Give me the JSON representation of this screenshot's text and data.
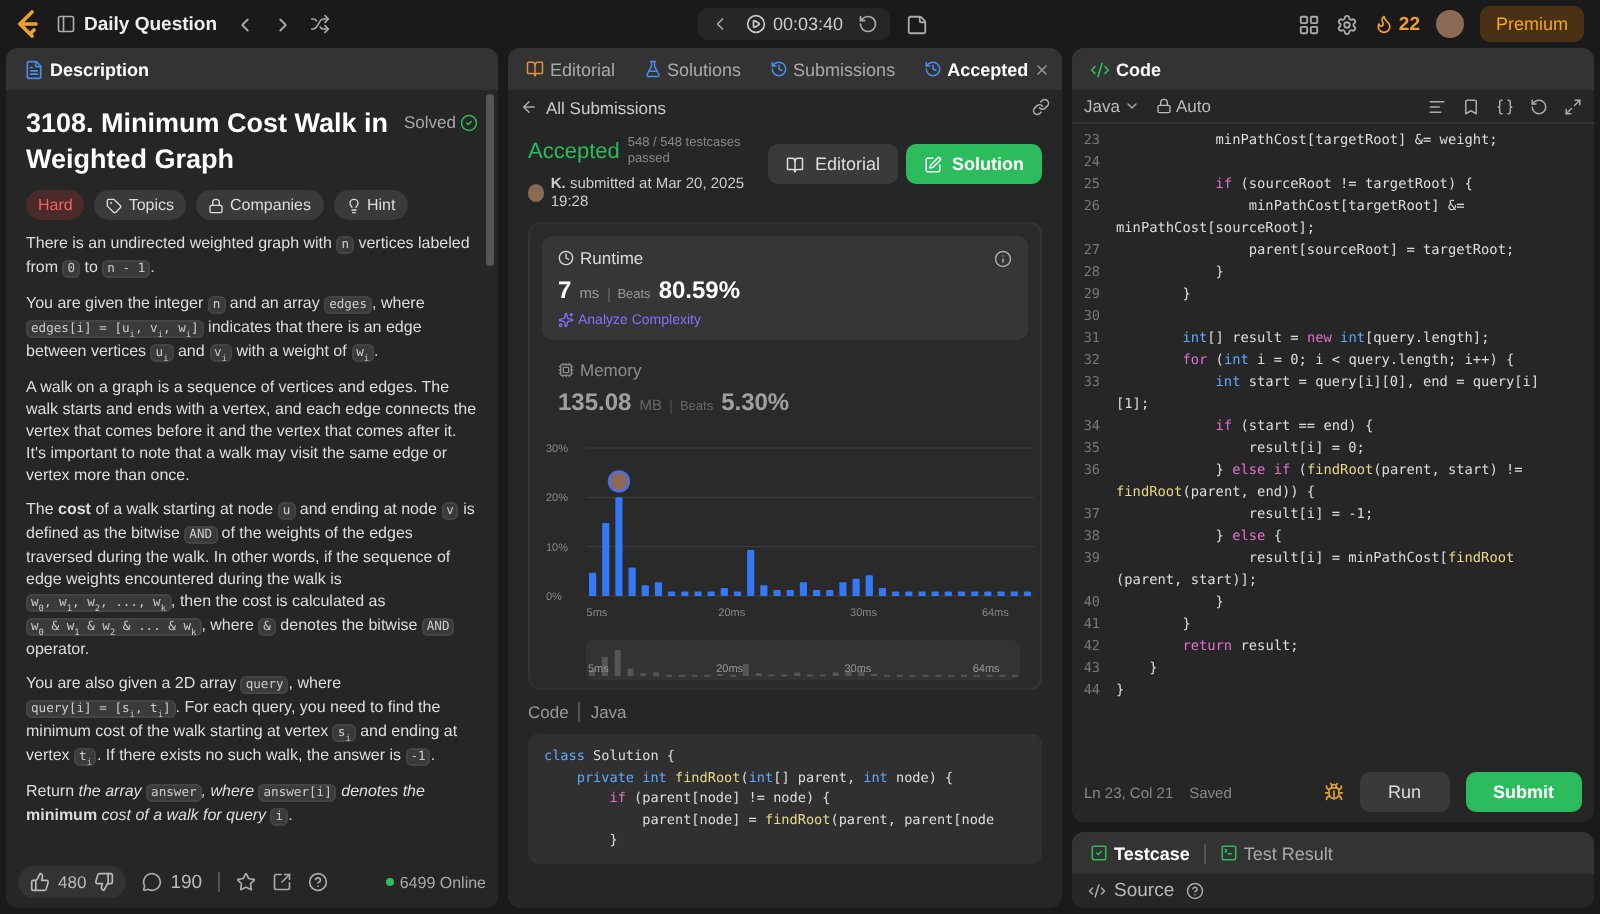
{
  "top_bar": {
    "title": "Daily Question",
    "timer": "00:03:40",
    "streak": "22",
    "premium": "Premium"
  },
  "description_panel": {
    "tab": {
      "label": "Description",
      "selected": true
    },
    "title": "3108. Minimum Cost Walk in Weighted Graph",
    "status": "Solved",
    "difficulty": "Hard",
    "tags": [
      "Topics",
      "Companies",
      "Hint"
    ],
    "paragraphs": [
      [
        {
          "kind": "text",
          "text": "There is an undirected weighted graph with "
        },
        {
          "kind": "code",
          "text": "n"
        },
        {
          "kind": "text",
          "text": " vertices labeled from "
        },
        {
          "kind": "code",
          "text": "0"
        },
        {
          "kind": "text",
          "text": " to "
        },
        {
          "kind": "code",
          "text": "n - 1"
        },
        {
          "kind": "text",
          "text": "."
        }
      ],
      [
        {
          "kind": "text",
          "text": "You are given the integer "
        },
        {
          "kind": "code",
          "text": "n"
        },
        {
          "kind": "text",
          "text": " and an array "
        },
        {
          "kind": "code",
          "text": "edges"
        },
        {
          "kind": "text",
          "text": ", where "
        },
        {
          "kind": "code",
          "text": "edges[i] = [u$_{i}$, v$_{i}$, w$_{i}$]"
        },
        {
          "kind": "text",
          "text": " indicates that there is an edge between vertices "
        },
        {
          "kind": "code",
          "text": "u$_{i}$"
        },
        {
          "kind": "text",
          "text": " and "
        },
        {
          "kind": "code",
          "text": "v$_{i}$"
        },
        {
          "kind": "text",
          "text": " with a weight of "
        },
        {
          "kind": "code",
          "text": "w$_{i}$"
        },
        {
          "kind": "text",
          "text": "."
        }
      ],
      [
        {
          "kind": "text",
          "text": "A walk on a graph is a sequence of vertices and edges. The walk starts and ends with a vertex, and each edge connects the vertex that comes before it and the vertex that comes after it. It's important to note that a walk may visit the same edge or vertex more than once."
        }
      ],
      [
        {
          "kind": "text",
          "text": "The **cost** of a walk starting at node "
        },
        {
          "kind": "code",
          "text": "u"
        },
        {
          "kind": "text",
          "text": " and ending at node "
        },
        {
          "kind": "code",
          "text": "v"
        },
        {
          "kind": "text",
          "text": " is defined as the bitwise "
        },
        {
          "kind": "code",
          "text": "AND"
        },
        {
          "kind": "text",
          "text": " of the weights of the edges traversed during the walk. In other words, if the sequence of edge weights encountered during the walk is "
        },
        {
          "kind": "code",
          "text": "w$_{0}$, w$_{1}$, w$_{2}$, ..., w$_{k}$"
        },
        {
          "kind": "text",
          "text": ", then the cost is calculated as "
        },
        {
          "kind": "code",
          "text": "w$_{0}$ & w$_{1}$ & w$_{2}$ & ... & w$_{k}$"
        },
        {
          "kind": "text",
          "text": ", where "
        },
        {
          "kind": "code",
          "text": "&"
        },
        {
          "kind": "text",
          "text": " denotes the bitwise "
        },
        {
          "kind": "code",
          "text": "AND"
        },
        {
          "kind": "text",
          "text": " operator."
        }
      ],
      [
        {
          "kind": "text",
          "text": "You are also given a 2D array "
        },
        {
          "kind": "code",
          "text": "query"
        },
        {
          "kind": "text",
          "text": ", where "
        },
        {
          "kind": "code",
          "text": "query[i] = [s$_{i}$, t$_{i}$]"
        },
        {
          "kind": "text",
          "text": ". For each query, you need to find the minimum cost of the walk starting at vertex "
        },
        {
          "kind": "code",
          "text": "s$_{i}$"
        },
        {
          "kind": "text",
          "text": " and ending at vertex "
        },
        {
          "kind": "code",
          "text": "t$_{i}$"
        },
        {
          "kind": "text",
          "text": ". If there exists no such walk, the answer is "
        },
        {
          "kind": "code",
          "text": "-1"
        },
        {
          "kind": "text",
          "text": "."
        }
      ],
      [
        {
          "kind": "text",
          "text": "Return *the array* "
        },
        {
          "kind": "code",
          "text": "answer"
        },
        {
          "kind": "text",
          "text": "*, where* "
        },
        {
          "kind": "code",
          "text": "answer[i]"
        },
        {
          "kind": "text",
          "text": " *denotes the* **minimum** *cost of a walk for query* "
        },
        {
          "kind": "code",
          "text": "i"
        },
        {
          "kind": "text",
          "text": "."
        }
      ]
    ],
    "footer": {
      "likes": "480",
      "comments": "190",
      "online": "6499 Online"
    }
  },
  "submission_panel": {
    "tabs": [
      {
        "label": "Editorial",
        "selected": false,
        "closable": false
      },
      {
        "label": "Solutions",
        "selected": false,
        "closable": false
      },
      {
        "label": "Submissions",
        "selected": false,
        "closable": false
      },
      {
        "label": "Accepted",
        "selected": true,
        "closable": true
      }
    ],
    "back_link": "All Submissions",
    "verdict": "Accepted",
    "testcases": "548 / 548 testcases passed",
    "submitted": "**K.** submitted at Mar 20, 2025 19:28",
    "buttons": [
      {
        "label": "Editorial",
        "kind": "secondary"
      },
      {
        "label": "Solution",
        "kind": "primary"
      }
    ],
    "metrics": [
      {
        "label": "Runtime",
        "value": "7",
        "unit": "ms",
        "beats_label": "Beats",
        "beats": "80.59%",
        "link": "Analyze Complexity",
        "selected": true
      },
      {
        "label": "Memory",
        "value": "135.08",
        "unit": "MB",
        "beats_label": "Beats",
        "beats": "5.30%",
        "selected": false
      }
    ],
    "chart_data": {
      "type": "bar",
      "categories": [
        "5ms",
        null,
        null,
        null,
        null,
        null,
        null,
        null,
        null,
        null,
        "20ms",
        null,
        null,
        null,
        null,
        null,
        null,
        null,
        null,
        null,
        "30ms",
        null,
        null,
        null,
        null,
        null,
        null,
        null,
        null,
        null,
        "64ms",
        null,
        null,
        null
      ],
      "values": [
        4.7,
        14.8,
        20,
        5.8,
        2.2,
        2.8,
        0.9,
        0.9,
        0.9,
        0.9,
        1.6,
        0.9,
        9.3,
        2.2,
        1.2,
        1.2,
        2.8,
        1.2,
        1.2,
        2.8,
        3.5,
        4.2,
        1.6,
        0.9,
        0.9,
        0.9,
        0.9,
        0.9,
        0.9,
        0.9,
        0.9,
        0.9,
        0.9,
        0.9
      ],
      "ylim": [
        0,
        30
      ],
      "yticks": [
        {
          "value": 0,
          "label": "0%"
        },
        {
          "value": 10,
          "label": "10%"
        },
        {
          "value": 20,
          "label": "20%"
        },
        {
          "value": 30,
          "label": "30%"
        }
      ]
    },
    "overview_labels": [
      "5ms",
      "20ms",
      "30ms",
      "64ms"
    ],
    "code_label": "Code",
    "code_language": "Java",
    "code": [
      [
        {
          "kind": "type",
          "text": "class"
        },
        {
          "kind": "p",
          "text": " Solution {"
        }
      ],
      [
        {
          "kind": "type",
          "text": "    private int"
        },
        {
          "kind": "fn",
          "text": " findRoot"
        },
        {
          "kind": "p",
          "text": "("
        },
        {
          "kind": "type",
          "text": "int"
        },
        {
          "kind": "p",
          "text": "[] parent, "
        },
        {
          "kind": "type",
          "text": "int"
        },
        {
          "kind": "p",
          "text": " node) {"
        }
      ],
      [
        {
          "kind": "kw",
          "text": "        if"
        },
        {
          "kind": "p",
          "text": " (parent[node] != node) {"
        }
      ],
      [
        {
          "kind": "p",
          "text": "            parent[node] = "
        },
        {
          "kind": "fn",
          "text": "findRoot"
        },
        {
          "kind": "p",
          "text": "(parent, parent[node"
        }
      ],
      [
        {
          "kind": "p",
          "text": "        }"
        }
      ]
    ]
  },
  "code_panel": {
    "title": "Code",
    "language": "Java",
    "mode": "Auto",
    "rows": [
      {
        "num": "23",
        "code": [
          {
            "kind": "p",
            "text": "            minPathCost[targetRoot] &= weight;"
          }
        ]
      },
      {
        "num": "24"
      },
      {
        "num": "25",
        "code": [
          {
            "kind": "kw",
            "text": "            if"
          },
          {
            "kind": "p",
            "text": " (sourceRoot != targetRoot) {"
          }
        ]
      },
      {
        "num": "26",
        "code": [
          {
            "kind": "p",
            "text": "                minPathCost[targetRoot] &="
          }
        ]
      },
      {
        "code": [
          {
            "kind": "p",
            "text": "minPathCost[sourceRoot];"
          }
        ]
      },
      {
        "num": "27",
        "code": [
          {
            "kind": "p",
            "text": "                parent[sourceRoot] = targetRoot;"
          }
        ]
      },
      {
        "num": "28",
        "code": [
          {
            "kind": "p",
            "text": "            }"
          }
        ]
      },
      {
        "num": "29",
        "code": [
          {
            "kind": "p",
            "text": "        }"
          }
        ]
      },
      {
        "num": "30"
      },
      {
        "num": "31",
        "code": [
          {
            "kind": "type",
            "text": "        int"
          },
          {
            "kind": "p",
            "text": "[] result = "
          },
          {
            "kind": "kw",
            "text": "new"
          },
          {
            "kind": "type",
            "text": " int"
          },
          {
            "kind": "p",
            "text": "[query.length];"
          }
        ]
      },
      {
        "num": "32",
        "code": [
          {
            "kind": "kw",
            "text": "        for"
          },
          {
            "kind": "p",
            "text": " ("
          },
          {
            "kind": "type",
            "text": "int"
          },
          {
            "kind": "p",
            "text": " i = 0; i < query.length; i++) {"
          }
        ]
      },
      {
        "num": "33",
        "code": [
          {
            "kind": "type",
            "text": "            int"
          },
          {
            "kind": "p",
            "text": " start = query[i][0], end = query[i]"
          }
        ]
      },
      {
        "code": [
          {
            "kind": "p",
            "text": "[1];"
          }
        ]
      },
      {
        "num": "34",
        "code": [
          {
            "kind": "kw",
            "text": "            if"
          },
          {
            "kind": "p",
            "text": " (start == end) {"
          }
        ]
      },
      {
        "num": "35",
        "code": [
          {
            "kind": "p",
            "text": "                result[i] = 0;"
          }
        ]
      },
      {
        "num": "36",
        "code": [
          {
            "kind": "p",
            "text": "            } "
          },
          {
            "kind": "kw",
            "text": "else if"
          },
          {
            "kind": "p",
            "text": " ("
          },
          {
            "kind": "fn",
            "text": "findRoot"
          },
          {
            "kind": "p",
            "text": "(parent, start) !="
          }
        ]
      },
      {
        "code": [
          {
            "kind": "fn",
            "text": "findRoot"
          },
          {
            "kind": "p",
            "text": "(parent, end)) {"
          }
        ]
      },
      {
        "num": "37",
        "code": [
          {
            "kind": "p",
            "text": "                result[i] = -1;"
          }
        ]
      },
      {
        "num": "38",
        "code": [
          {
            "kind": "p",
            "text": "            } "
          },
          {
            "kind": "kw",
            "text": "else"
          },
          {
            "kind": "p",
            "text": " {"
          }
        ]
      },
      {
        "num": "39",
        "code": [
          {
            "kind": "p",
            "text": "                result[i] = minPathCost["
          },
          {
            "kind": "fn",
            "text": "findRoot"
          }
        ]
      },
      {
        "code": [
          {
            "kind": "p",
            "text": "(parent, start)];"
          }
        ]
      },
      {
        "num": "40",
        "code": [
          {
            "kind": "p",
            "text": "            }"
          }
        ]
      },
      {
        "num": "41",
        "code": [
          {
            "kind": "p",
            "text": "        }"
          }
        ]
      },
      {
        "num": "42",
        "code": [
          {
            "kind": "kw",
            "text": "        return"
          },
          {
            "kind": "p",
            "text": " result;"
          }
        ]
      },
      {
        "num": "43",
        "code": [
          {
            "kind": "p",
            "text": "    }"
          }
        ]
      },
      {
        "num": "44",
        "code": [
          {
            "kind": "p",
            "text": "}"
          }
        ]
      }
    ],
    "cursor": "Ln 23, Col 21",
    "saved": "Saved",
    "buttons": [
      {
        "label": "Run",
        "kind": "secondary"
      },
      {
        "label": "Submit",
        "kind": "primary"
      }
    ]
  },
  "test_panel": {
    "tabs": [
      {
        "label": "Testcase",
        "selected": true
      },
      {
        "label": "Test Result",
        "selected": false
      }
    ],
    "source": "Source"
  }
}
